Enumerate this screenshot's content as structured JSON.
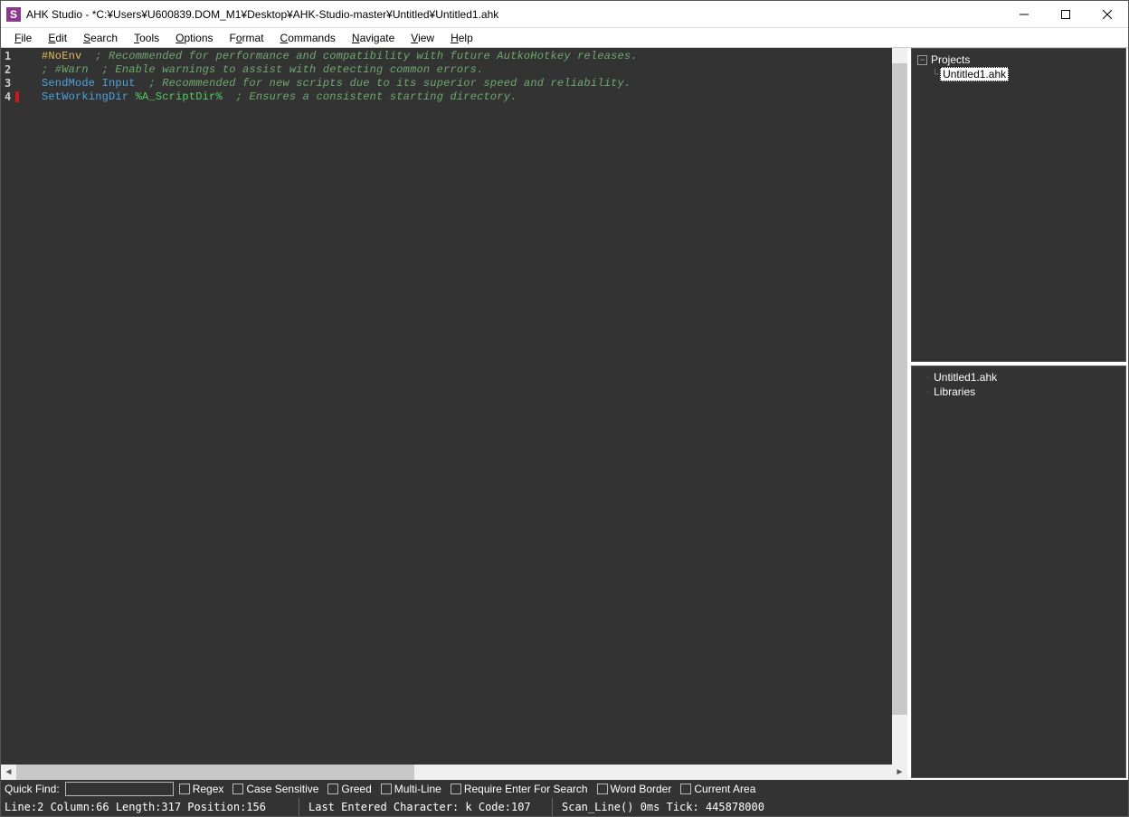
{
  "title": "AHK Studio - *C:¥Users¥U600839.DOM_M1¥Desktop¥AHK-Studio-master¥Untitled¥Untitled1.ahk",
  "app_icon_letter": "S",
  "menu": [
    "File",
    "Edit",
    "Search",
    "Tools",
    "Options",
    "Format",
    "Commands",
    "Navigate",
    "View",
    "Help"
  ],
  "code": {
    "lines": [
      {
        "n": "1",
        "tokens": [
          {
            "t": "#NoEnv",
            "c": "tok-dir"
          },
          {
            "t": "  ",
            "c": ""
          },
          {
            "t": "; Recommended for performance and compatibility with future AutkoHotkey releases.",
            "c": "tok-cmt"
          }
        ]
      },
      {
        "n": "2",
        "tokens": [
          {
            "t": "; #Warn  ; Enable warnings to assist with detecting common errors.",
            "c": "tok-cmt"
          }
        ]
      },
      {
        "n": "3",
        "tokens": [
          {
            "t": "SendMode",
            "c": "tok-cmd"
          },
          {
            "t": " ",
            "c": ""
          },
          {
            "t": "Input",
            "c": "tok-arg"
          },
          {
            "t": "  ",
            "c": ""
          },
          {
            "t": "; Recommended for new scripts due to its superior speed and reliability.",
            "c": "tok-cmt"
          }
        ]
      },
      {
        "n": "4",
        "marker": true,
        "tokens": [
          {
            "t": "SetWorkingDir",
            "c": "tok-cmd2"
          },
          {
            "t": " ",
            "c": ""
          },
          {
            "t": "%A_ScriptDir%",
            "c": "tok-var"
          },
          {
            "t": "  ",
            "c": ""
          },
          {
            "t": "; Ensures a consistent starting directory.",
            "c": "tok-cmt"
          }
        ]
      }
    ]
  },
  "projects_panel": {
    "title": "Projects",
    "selected": "Untitled1.ahk"
  },
  "explorer_panel": {
    "items": [
      "Untitled1.ahk",
      "Libraries"
    ]
  },
  "quickfind": {
    "label": "Quick Find:",
    "checks": [
      "Regex",
      "Case Sensitive",
      "Greed",
      "Multi-Line",
      "Require Enter For Search",
      "Word Border",
      "Current Area"
    ]
  },
  "status": {
    "pos": "Line:2 Column:66 Length:317 Position:156",
    "lastchar": "Last Entered Character: k Code:107",
    "scan": "Scan_Line() 0ms Tick: 445878000"
  }
}
